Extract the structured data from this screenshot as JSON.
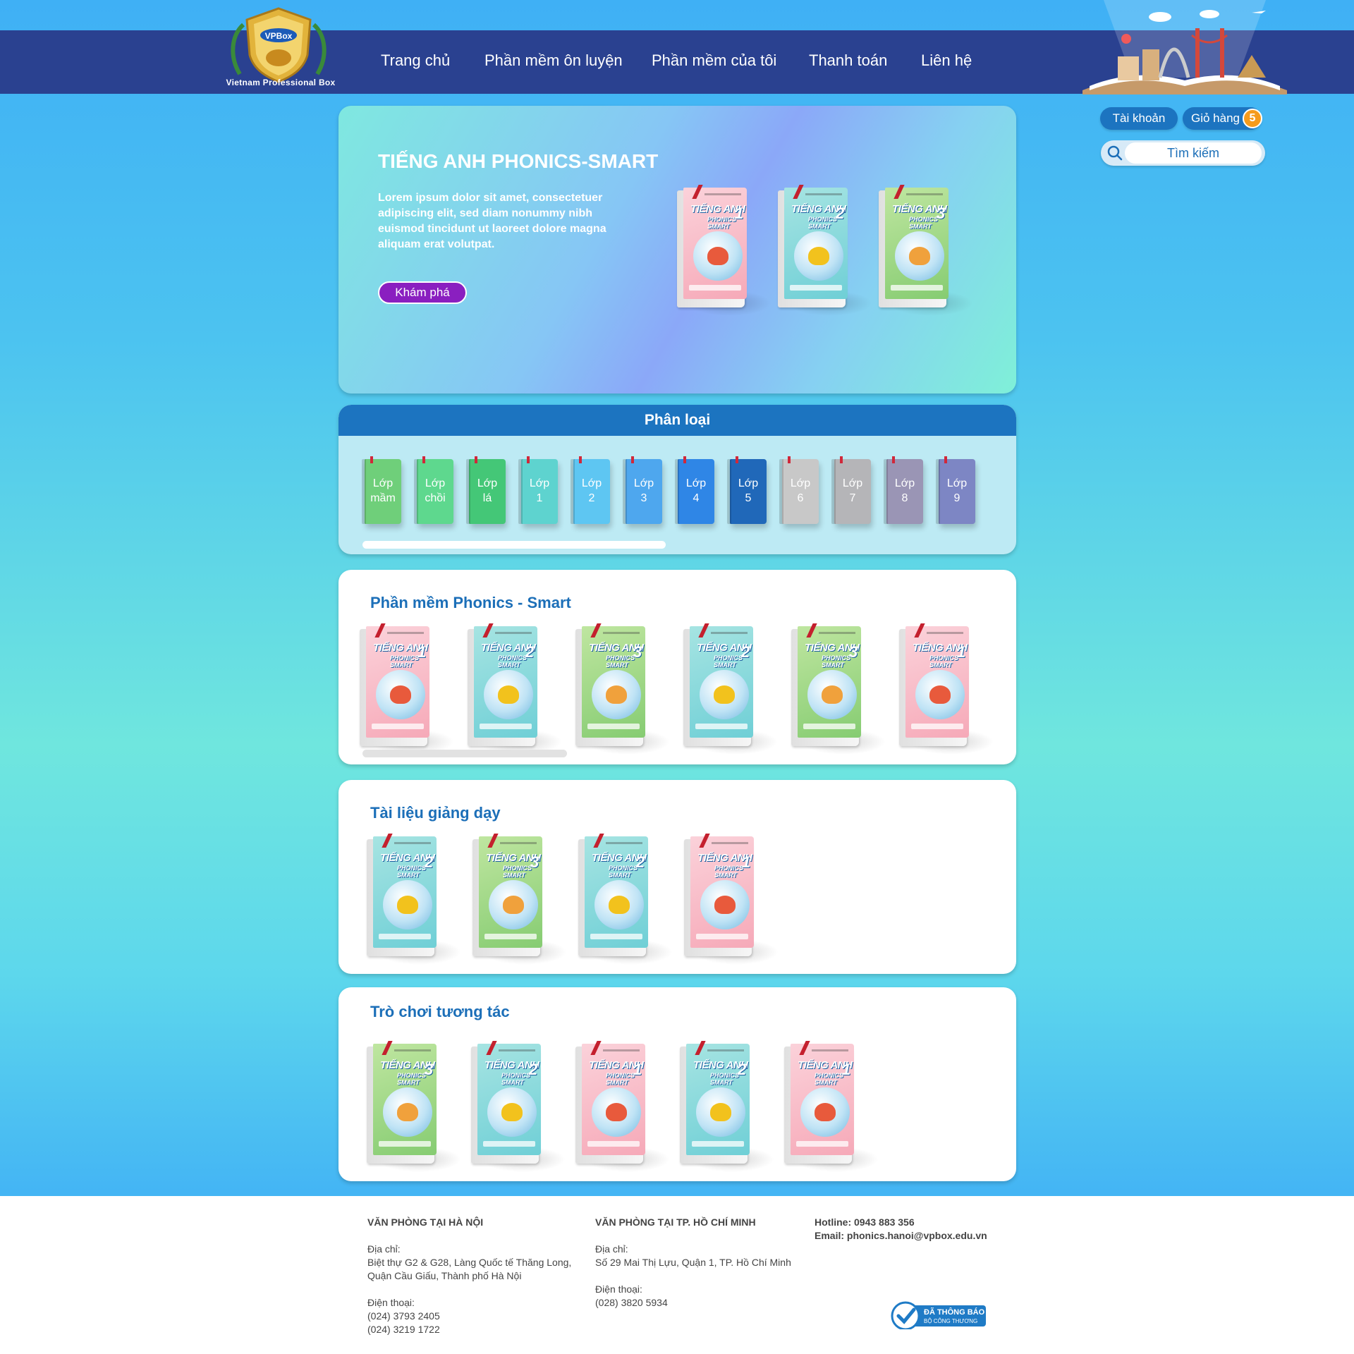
{
  "brand": {
    "logo_text": "Vietnam Professional Box",
    "logo_badge": "VPBox"
  },
  "nav": [
    {
      "label": "Trang chủ"
    },
    {
      "label": "Phần mềm ôn luyện"
    },
    {
      "label": "Phần mềm của tôi"
    },
    {
      "label": "Thanh toán"
    },
    {
      "label": "Liên hệ"
    }
  ],
  "account": {
    "account_label": "Tài khoản",
    "cart_label": "Giỏ hàng",
    "cart_count": "5"
  },
  "search": {
    "placeholder": "Tìm kiếm"
  },
  "hero": {
    "title": "TIẾNG ANH PHONICS-SMART",
    "description": "Lorem ipsum dolor sit amet, consectetuer adipiscing elit, sed diam nonummy nibh euismod tincidunt ut laoreet dolore magna aliquam erat volutpat.",
    "button": "Khám phá",
    "books": [
      "1",
      "2",
      "3"
    ]
  },
  "book_cover": {
    "title": "TIẾNG ANH",
    "subtitle": "PHONICS SMART"
  },
  "categories": {
    "title": "Phân loại",
    "items": [
      {
        "l1": "Lớp",
        "l2": "mầm",
        "color": "#6fcf7a"
      },
      {
        "l1": "Lớp",
        "l2": "chồi",
        "color": "#5ed88e"
      },
      {
        "l1": "Lớp",
        "l2": "lá",
        "color": "#44c777"
      },
      {
        "l1": "Lớp",
        "l2": "1",
        "color": "#5ed3cf"
      },
      {
        "l1": "Lớp",
        "l2": "2",
        "color": "#5ec6f2"
      },
      {
        "l1": "Lớp",
        "l2": "3",
        "color": "#4ea7ee"
      },
      {
        "l1": "Lớp",
        "l2": "4",
        "color": "#2f86e6"
      },
      {
        "l1": "Lớp",
        "l2": "5",
        "color": "#2068b9"
      },
      {
        "l1": "Lớp",
        "l2": "6",
        "color": "#c8c8c8"
      },
      {
        "l1": "Lớp",
        "l2": "7",
        "color": "#b5b5b8"
      },
      {
        "l1": "Lớp",
        "l2": "8",
        "color": "#9a95b5"
      },
      {
        "l1": "Lớp",
        "l2": "9",
        "color": "#7d86c4"
      }
    ]
  },
  "sections": [
    {
      "title": "Phần mềm Phonics - Smart",
      "books": [
        "1",
        "2",
        "3",
        "2",
        "3",
        "1"
      ]
    },
    {
      "title": "Tài liệu giảng dạy",
      "books": [
        "2",
        "3",
        "2",
        "1"
      ]
    },
    {
      "title": "Trò chơi tương tác",
      "books": [
        "3",
        "2",
        "1",
        "2",
        "1"
      ]
    }
  ],
  "footer": {
    "hanoi": {
      "heading": "VĂN PHÒNG TẠI HÀ NỘI",
      "address_label": "Địa chỉ:",
      "address_1": "Biệt thự G2 & G28, Làng Quốc tế Thăng Long,",
      "address_2": "Quận Cầu Giấu, Thành phố Hà Nội",
      "phone_label": "Điện thoại:",
      "phone_1": "(024) 3793 2405",
      "phone_2": "(024) 3219 1722"
    },
    "hcm": {
      "heading": "VĂN PHÒNG TẠI TP. HỒ CHÍ MINH",
      "address_label": "Địa chỉ:",
      "address_1": "Số 29 Mai Thị Lựu, Quận 1, TP. Hồ Chí Minh",
      "phone_label": "Điện thoại:",
      "phone_1": "(028) 3820 5934"
    },
    "contact": {
      "hotline": "Hotline: 0943 883 356",
      "email": "Email: phonics.hanoi@vpbox.edu.vn"
    },
    "gov_badge": {
      "line1": "ĐÃ THÔNG BÁO",
      "line2": "BỘ CÔNG THƯƠNG"
    }
  },
  "colors": {
    "nav_bg": "#2a4190",
    "accent_blue": "#1c74c0",
    "title_blue": "#1c6fb8",
    "button_purple": "#8a1fc0",
    "badge_orange": "#f59b1c",
    "book_1": "#f6b3c0",
    "book_2": "#7fd6d8",
    "book_3": "#9ad67e"
  }
}
